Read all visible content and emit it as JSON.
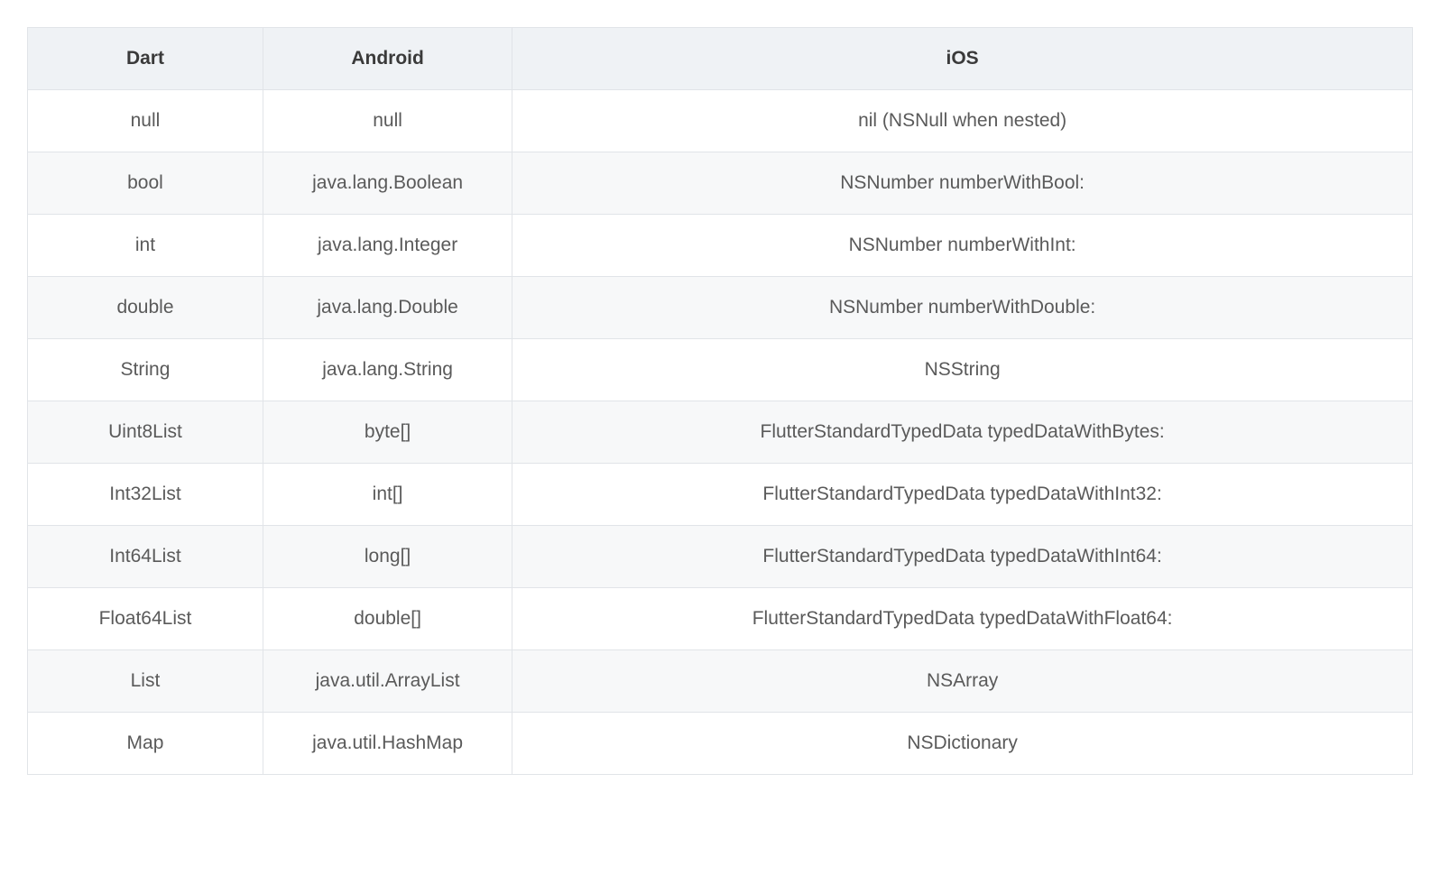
{
  "table": {
    "headers": {
      "dart": "Dart",
      "android": "Android",
      "ios": "iOS"
    },
    "rows": [
      {
        "dart": "null",
        "android": "null",
        "ios": "nil (NSNull when nested)"
      },
      {
        "dart": "bool",
        "android": "java.lang.Boolean",
        "ios": "NSNumber numberWithBool:"
      },
      {
        "dart": "int",
        "android": "java.lang.Integer",
        "ios": "NSNumber numberWithInt:"
      },
      {
        "dart": "double",
        "android": "java.lang.Double",
        "ios": "NSNumber numberWithDouble:"
      },
      {
        "dart": "String",
        "android": "java.lang.String",
        "ios": "NSString"
      },
      {
        "dart": "Uint8List",
        "android": "byte[]",
        "ios": "FlutterStandardTypedData typedDataWithBytes:"
      },
      {
        "dart": "Int32List",
        "android": "int[]",
        "ios": "FlutterStandardTypedData typedDataWithInt32:"
      },
      {
        "dart": "Int64List",
        "android": "long[]",
        "ios": "FlutterStandardTypedData typedDataWithInt64:"
      },
      {
        "dart": "Float64List",
        "android": "double[]",
        "ios": "FlutterStandardTypedData typedDataWithFloat64:"
      },
      {
        "dart": "List",
        "android": "java.util.ArrayList",
        "ios": "NSArray"
      },
      {
        "dart": "Map",
        "android": "java.util.HashMap",
        "ios": "NSDictionary"
      }
    ]
  }
}
